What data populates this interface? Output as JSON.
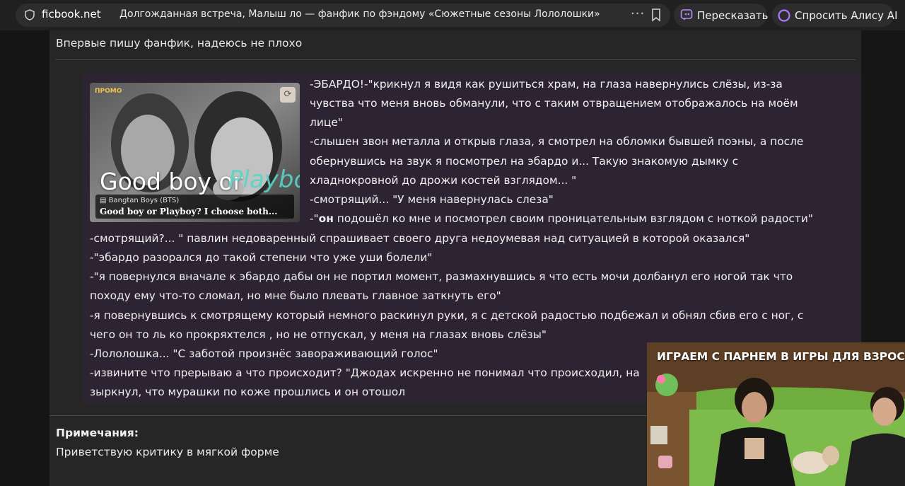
{
  "browser": {
    "domain": "ficbook.net",
    "title": "Долгожданная встреча, Малыш ло — фанфик по фэндому «Сюжетные сезоны Лололошки»",
    "more": "···",
    "retell_label": "Пересказать",
    "alice_label": "Спросить Алису AI"
  },
  "page": {
    "intro": "Впервые пишу фанфик, надеюсь не плохо",
    "promo": {
      "badge": "ПРОМО",
      "headline_white": "Good boy or",
      "headline_teal": "Playboy?",
      "fandom": "Bangtan Boys (BTS)",
      "name": "Good boy or Playboy? I choose both..."
    },
    "story_lines": [
      "-ЭБАРДО!-\"крикнул я видя как рушиться храм, на глаза навернулись слёзы, из-за",
      "чувства что меня вновь обманули, что с таким отвращением отображалось на моём",
      "лице\"",
      "-слышен звон металла и открыв глаза, я смотрел на обломки бывшей поэны, а после",
      "обернувшись на звук я посмотрел на эбардо и... Такую знакомую дымку с",
      "хладнокровной до дрожи костей взглядом... \"",
      "-смотрящий... \"У меня навернулась слеза\"",
      "",
      "-смотрящий?... \" павлин недоваренный спрашивает своего друга недоумевая над ситуацией в которой оказался\"",
      "-\"эбардо разорался до такой степени что уже уши болели\"",
      "-\"я повернулся вначале к эбардо дабы он не портил момент, размахнувшись я что есть мочи долбанул его ногой так что",
      "походу ему что-то сломал, но мне было плевать главное заткнуть его\"",
      "-я повернувшись к смотрящему который немного раскинул руки, я с детской радостью подбежал и обнял сбив его с ног, с",
      "чего он то ль ко прокряхтелся , но не отпускал, у меня на глазах вновь слёзы\"",
      "-Лололошка... \"С заботой произнёс завораживающий голос\"",
      "-извините что прерываю а что происходит? \"Джодах искренно не понимал что происходил, на",
      "зыркнул, что мурашки по коже прошлись и он отошол"
    ],
    "line8_prefix": "-\"",
    "line8_bold": "он",
    "line8_rest": " подошёл ко мне и посмотрел своим проницательным взглядом с ноткой радости\"",
    "notes_heading": "Примечания:",
    "notes_text": "Приветствую критику в мягкой форме"
  },
  "video": {
    "title": "ИГРАЕМ С ПАРНЕМ В ИГРЫ ДЛЯ ВЗРОСЛ"
  },
  "colors": {
    "story_bg": "#2d2433",
    "content_bg": "#262626",
    "topbar": "#202020",
    "pill": "#2d2d2d"
  }
}
